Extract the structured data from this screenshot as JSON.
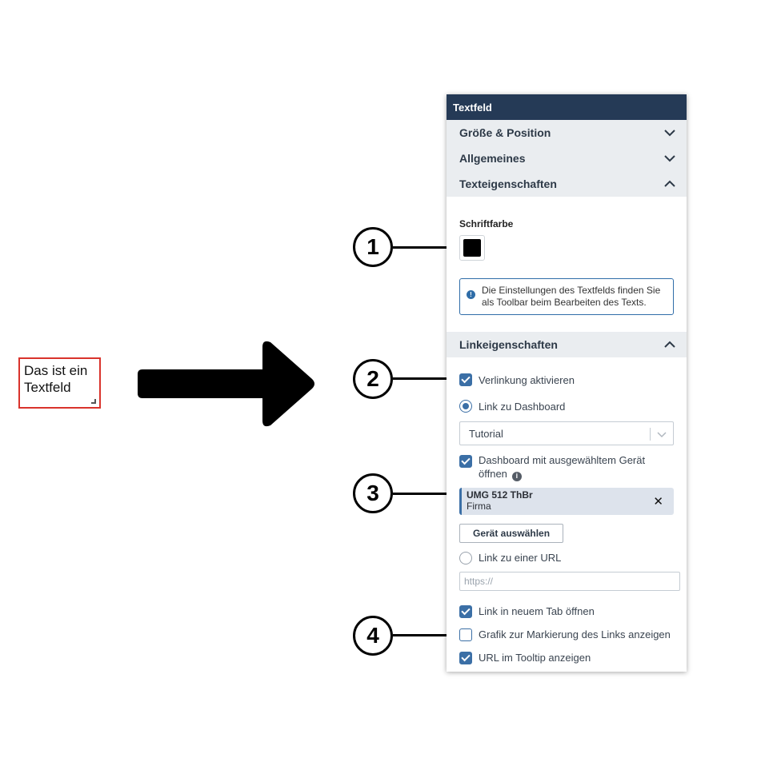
{
  "sample": {
    "text_line1": "Das ist ein",
    "text_line2": "Textfeld"
  },
  "callouts": [
    "1",
    "2",
    "3",
    "4"
  ],
  "panel": {
    "title": "Textfeld",
    "sections": {
      "size_position": "Größe & Position",
      "general": "Allgemeines",
      "text_properties": "Texteigenschaften",
      "link_properties": "Linkeigenschaften"
    },
    "text": {
      "font_color_label": "Schriftfarbe",
      "font_color": "#000000",
      "info_line1": "Die Einstellungen des Textfelds finden Sie",
      "info_line2": "als Toolbar beim Bearbeiten des Texts."
    },
    "link": {
      "enable_label": "Verlinkung aktivieren",
      "enable_checked": true,
      "dashboard_radio_label": "Link zu Dashboard",
      "dashboard_radio_checked": true,
      "dashboard_select_value": "Tutorial",
      "open_with_device_line1": "Dashboard mit ausgewähltem Gerät",
      "open_with_device_line2": "öffnen",
      "open_with_device_checked": true,
      "device_name": "UMG 512 ThBr",
      "device_sub": "Firma",
      "select_device_button": "Gerät auswählen",
      "url_radio_label": "Link zu einer URL",
      "url_radio_checked": false,
      "url_placeholder": "https://",
      "new_tab_label": "Link in neuem Tab öffnen",
      "new_tab_checked": true,
      "marker_label": "Grafik zur Markierung des Links anzeigen",
      "marker_checked": false,
      "tooltip_label": "URL im Tooltip anzeigen",
      "tooltip_checked": true
    }
  },
  "colors": {
    "header": "#253a56",
    "accent": "#3b6fa6",
    "sample_border": "#d9332c"
  }
}
